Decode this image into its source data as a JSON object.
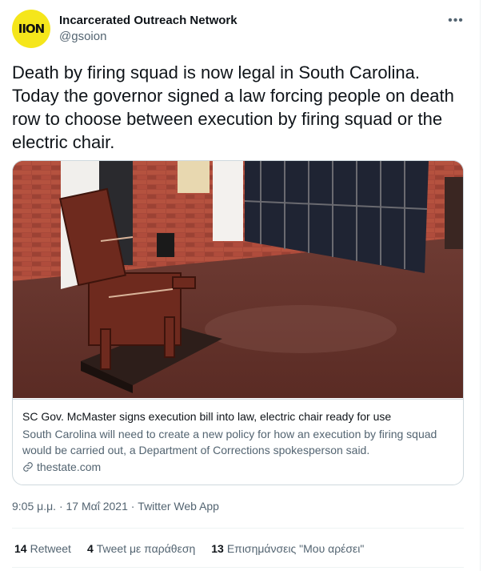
{
  "author": {
    "avatar_text": "IION",
    "name": "Incarcerated Outreach Network",
    "handle": "@gsoion"
  },
  "more_icon": "more-horizontal-icon",
  "tweet_text": "Death by firing squad is now legal in South Carolina. Today the governor signed a law forcing people on death row to choose between execution by firing squad or the electric chair.",
  "card": {
    "title": "SC Gov. McMaster signs execution bill into law, electric chair ready for use",
    "description": "South Carolina will need to create a new policy for how an execution by firing squad would be carried out, a Department of Corrections spokesperson said.",
    "domain": "thestate.com",
    "link_icon": "link-icon"
  },
  "meta": {
    "timestamp": "9:05 μ.μ. · 17 Μαΐ 2021 · Twitter Web App"
  },
  "stats": [
    {
      "count": "14",
      "label": "Retweet"
    },
    {
      "count": "4",
      "label": "Tweet με παράθεση"
    },
    {
      "count": "13",
      "label": "Επισημάνσεις \"Μου αρέσει\""
    }
  ],
  "colors": {
    "avatar_bg": "#f5e61b",
    "secondary_text": "#536471",
    "border": "#cfd9de"
  }
}
